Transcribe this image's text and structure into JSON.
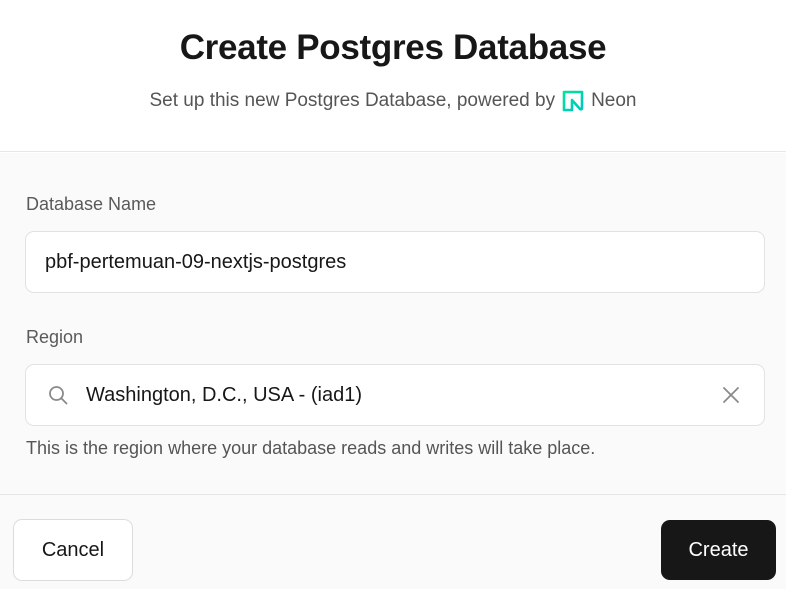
{
  "dialog": {
    "title": "Create Postgres Database",
    "subtitle": "Set up this new Postgres Database, powered by",
    "provider": {
      "name": "Neon",
      "icon": "neon-logo-icon",
      "brand_color": "#00e599"
    }
  },
  "form": {
    "database_name": {
      "label": "Database Name",
      "value": "pbf-pertemuan-09-nextjs-postgres"
    },
    "region": {
      "label": "Region",
      "value": "Washington, D.C., USA - (iad1)",
      "hint": "This is the region where your database reads and writes will take place.",
      "icons": {
        "search": "search-icon",
        "clear": "close-icon"
      }
    }
  },
  "footer": {
    "cancel_label": "Cancel",
    "create_label": "Create"
  },
  "colors": {
    "primary_button": "#171717",
    "border": "#e2e2e2",
    "muted_text": "#555555",
    "body_background": "#fafafa"
  }
}
